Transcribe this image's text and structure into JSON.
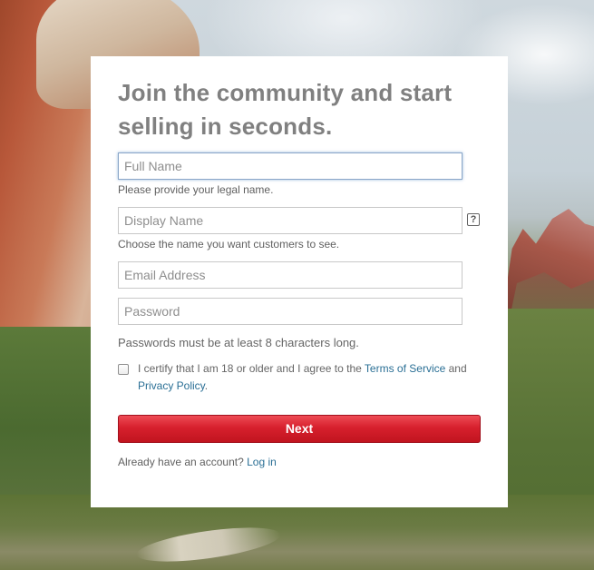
{
  "form": {
    "headline": "Join the community and start selling in seconds.",
    "full_name": {
      "placeholder": "Full Name",
      "value": "",
      "hint": "Please provide your legal name."
    },
    "display_name": {
      "placeholder": "Display Name",
      "value": "",
      "hint": "Choose the name you want customers to see.",
      "help_glyph": "?"
    },
    "email": {
      "placeholder": "Email Address",
      "value": ""
    },
    "password": {
      "placeholder": "Password",
      "value": "",
      "note": "Passwords must be at least 8 characters long."
    },
    "consent": {
      "checked": false,
      "text_before": "I certify that I am 18 or older and I agree to the ",
      "terms_link": "Terms of Service",
      "text_middle": " and ",
      "privacy_link": "Privacy Policy",
      "text_after": "."
    },
    "next_label": "Next",
    "login_prompt": "Already have an account? ",
    "login_link": "Log in"
  },
  "colors": {
    "headline": "#808080",
    "link": "#2a6f95",
    "button": "#d7202d",
    "panel": "#ffffff"
  },
  "icons": {
    "help": "question-mark-icon",
    "checkbox": "checkbox-unchecked"
  }
}
